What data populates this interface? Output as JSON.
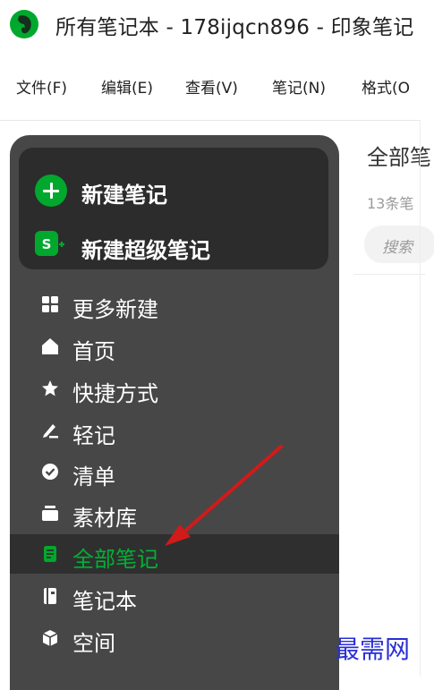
{
  "window": {
    "title": "所有笔记本 - 178ijqcn896 - 印象笔记"
  },
  "menu": [
    "文件(F)",
    "编辑(E)",
    "查看(V)",
    "笔记(N)",
    "格式(O"
  ],
  "sidebar": {
    "create": [
      {
        "label": "新建笔记",
        "icon": "plus-circle-icon"
      },
      {
        "label": "新建超级笔记",
        "icon": "super-note-icon"
      }
    ],
    "items": [
      {
        "label": "更多新建",
        "icon": "grid-icon"
      },
      {
        "label": "首页",
        "icon": "home-icon"
      },
      {
        "label": "快捷方式",
        "icon": "star-icon"
      },
      {
        "label": "轻记",
        "icon": "pen-icon"
      },
      {
        "label": "清单",
        "icon": "check-circle-icon"
      },
      {
        "label": "素材库",
        "icon": "archive-icon"
      },
      {
        "label": "全部笔记",
        "icon": "note-icon",
        "active": true
      },
      {
        "label": "笔记本",
        "icon": "notebook-icon"
      },
      {
        "label": "空间",
        "icon": "cube-icon"
      }
    ]
  },
  "main": {
    "header": "全部笔",
    "count": "13条笔",
    "search_placeholder": "搜索"
  },
  "watermark": "最需网",
  "colors": {
    "accent": "#00a82d",
    "sidebar_bg": "#474747",
    "arrow": "#d11a1a"
  }
}
